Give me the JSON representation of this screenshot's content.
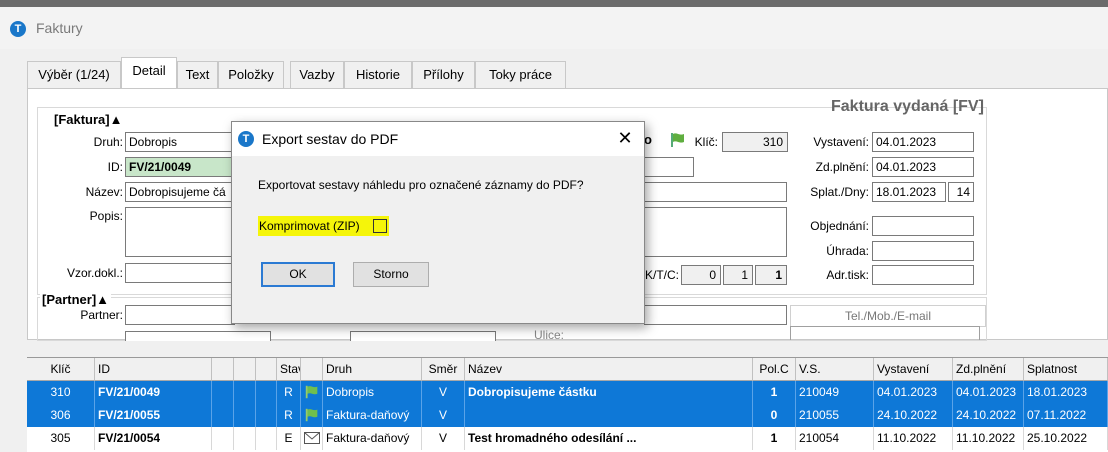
{
  "window": {
    "title": "Faktury",
    "icon": "app-logo-icon"
  },
  "tabs": [
    {
      "label": "Výběr (1/24)"
    },
    {
      "label": "Detail"
    },
    {
      "label": "Text"
    },
    {
      "label": "Položky"
    },
    {
      "label": "Vazby"
    },
    {
      "label": "Historie"
    },
    {
      "label": "Přílohy"
    },
    {
      "label": "Toky práce"
    }
  ],
  "detail": {
    "doc_type_title": "Faktura vydaná [FV]",
    "section_faktura": "[Faktura]▲",
    "section_partner": "[Partner]▲",
    "druh_label": "Druh:",
    "druh_value": "Dobropis",
    "id_label": "ID:",
    "id_value": "FV/21/0049",
    "nazev_label": "Název:",
    "nazev_value": "Dobropisujeme čá",
    "popis_label": "Popis:",
    "vzor_label": "Vzor.dokl.:",
    "partner_label": "Partner:",
    "ulice_label": "Ulice:",
    "o_fragment": "o",
    "klic_label": "Klíč:",
    "klic_value": "310",
    "vystaveni_label": "Vystavení:",
    "vystaveni_value": "04.01.2023",
    "zdpln_label": "Zd.plnění:",
    "zdpln_value": "04.01.2023",
    "splat_label": "Splat./Dny:",
    "splat_value": "18.01.2023",
    "splat_days": "14",
    "objednani_label": "Objednání:",
    "uhrada_label": "Úhrada:",
    "adrtisk_label": "Adr.tisk:",
    "ktc_label": "K/T/C:",
    "k_value": "0",
    "t_value": "1",
    "c_value": "1",
    "tel_label": "Tel./Mob./E-mail"
  },
  "dialog": {
    "title": "Export sestav do PDF",
    "message": "Exportovat sestavy náhledu pro označené záznamy do PDF?",
    "zip_label": "Komprimovat (ZIP)",
    "zip_checked": false,
    "ok": "OK",
    "cancel": "Storno",
    "highlight_color": "#f5f50a"
  },
  "grid": {
    "headers": [
      "Klíč",
      "ID",
      "",
      "",
      "",
      "Stav",
      "",
      "Druh",
      "Směr",
      "Název",
      "Pol.C",
      "V.S.",
      "Vystavení",
      "Zd.plnění",
      "Splatnost"
    ],
    "rows": [
      {
        "klic": "310",
        "id": "FV/21/0049",
        "stav": "R",
        "icon": "flag-icon",
        "druh": "Dobropis",
        "smer": "V",
        "nazev": "Dobropisujeme částku",
        "polc": "1",
        "vs": "210049",
        "vystaveni": "04.01.2023",
        "zdpln": "04.01.2023",
        "splat": "18.01.2023",
        "selected": true
      },
      {
        "klic": "306",
        "id": "FV/21/0055",
        "stav": "R",
        "icon": "flag-icon",
        "druh": "Faktura-daňový",
        "smer": "V",
        "nazev": "",
        "polc": "0",
        "vs": "210055",
        "vystaveni": "24.10.2022",
        "zdpln": "24.10.2022",
        "splat": "07.11.2022",
        "selected": true
      },
      {
        "klic": "305",
        "id": "FV/21/0054",
        "stav": "E",
        "icon": "envelope-icon",
        "druh": "Faktura-daňový",
        "smer": "V",
        "nazev": "Test hromadného odesílání ...",
        "polc": "1",
        "vs": "210054",
        "vystaveni": "11.10.2022",
        "zdpln": "11.10.2022",
        "splat": "25.10.2022",
        "selected": false
      }
    ]
  },
  "colors": {
    "selection": "#0e78d7",
    "accent": "#1a77c9",
    "id_field_bg": "#c8e6c9"
  }
}
